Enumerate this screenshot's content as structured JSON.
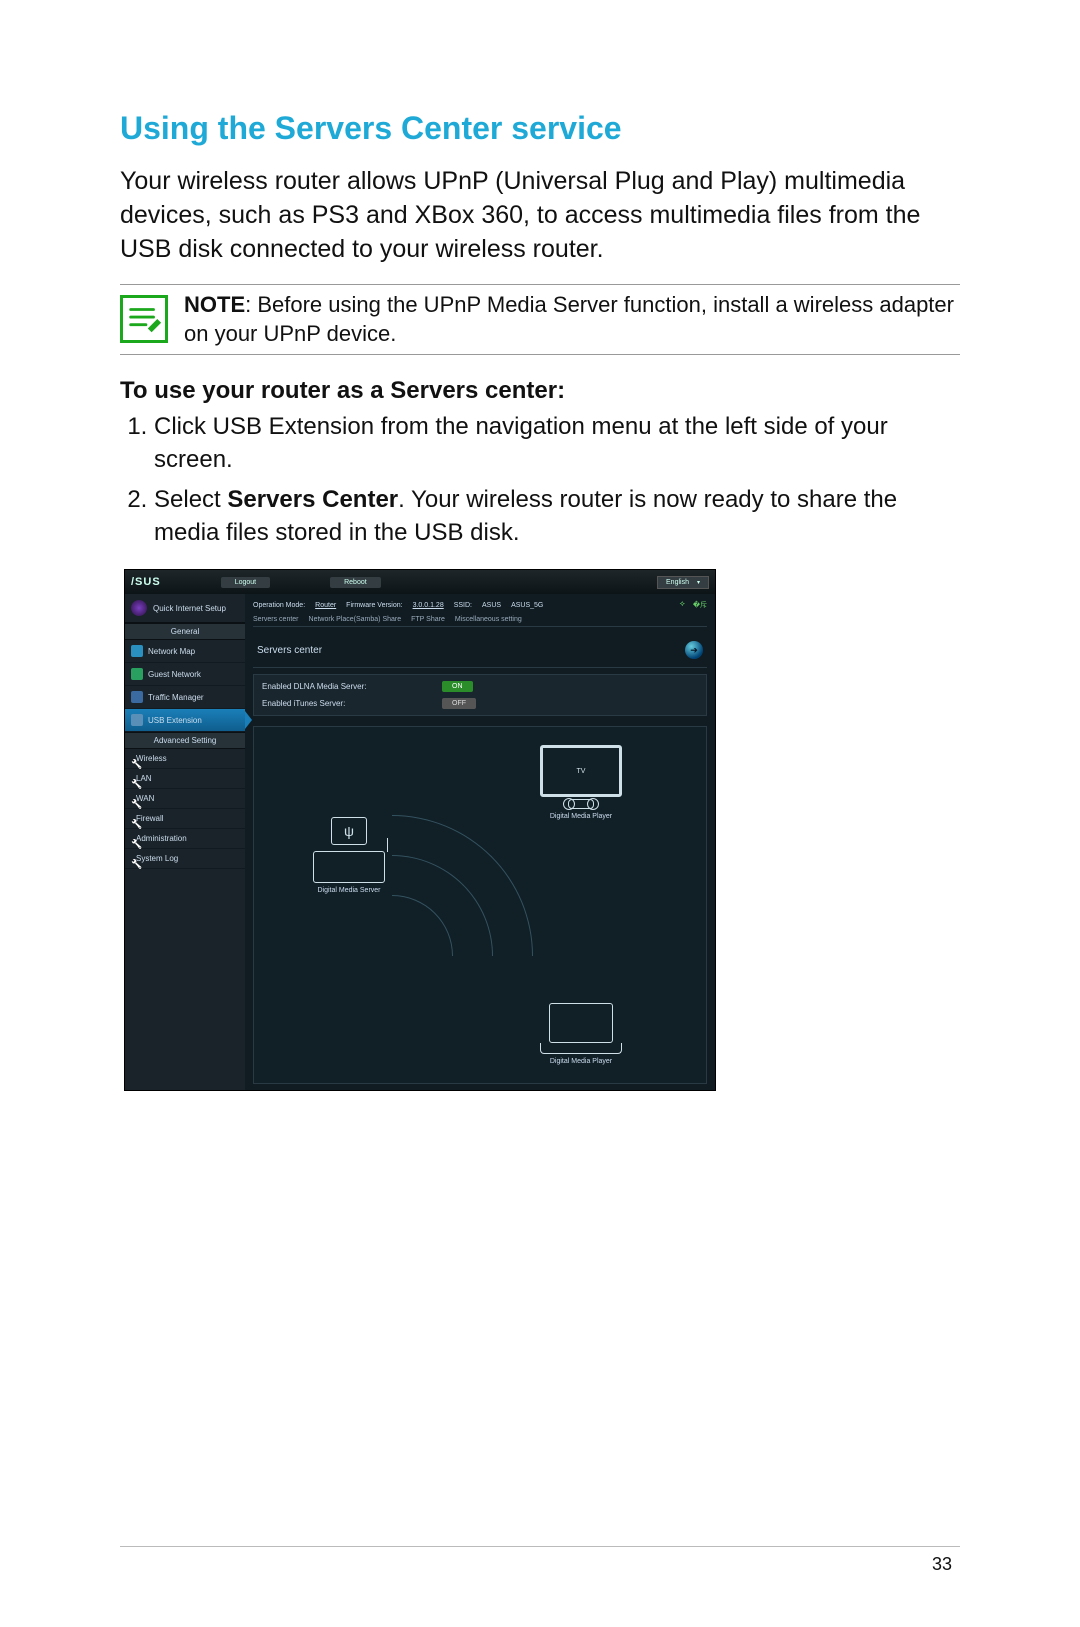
{
  "heading": "Using the Servers Center service",
  "intro": "Your wireless router allows UPnP (Universal Plug and Play) multimedia devices, such as PS3 and XBox 360, to access multimedia files from the USB disk connected to your wireless router.",
  "note": {
    "label": "NOTE",
    "text": ": Before using the UPnP Media Server function, install a wireless adapter on your UPnP device."
  },
  "subhead": "To use your router as a Servers center:",
  "steps": [
    "Click USB Extension from the navigation menu at the left side of your screen.",
    "Select <b>Servers Center</b>. Your wireless router is now ready to share the media files stored in the USB disk."
  ],
  "page_number": "33",
  "router": {
    "logo": "/SUS",
    "btn_logout": "Logout",
    "btn_reboot": "Reboot",
    "language": "English",
    "info": {
      "op_mode_lbl": "Operation Mode:",
      "op_mode_val": "Router",
      "fw_lbl": "Firmware Version:",
      "fw_val": "3.0.0.1.28",
      "ssid_lbl": "SSID:",
      "ssid1": "ASUS",
      "ssid2": "ASUS_5G"
    },
    "tabs": [
      "Servers center",
      "Network Place(Samba) Share",
      "FTP Share",
      "Miscellaneous setting"
    ],
    "panel_title": "Servers center",
    "settings": {
      "dlna_lbl": "Enabled DLNA Media Server:",
      "dlna_val": "ON",
      "itunes_lbl": "Enabled iTunes Server:",
      "itunes_val": "OFF"
    },
    "diagram": {
      "server_label": "Digital Media Server",
      "tv_label": "TV",
      "tv_caption": "Digital Media Player",
      "laptop_caption": "Digital Media Player"
    },
    "side": {
      "quick": "Quick Internet Setup",
      "cat_general": "General",
      "items_general": [
        "Network Map",
        "Guest Network",
        "Traffic Manager",
        "USB Extension"
      ],
      "cat_advanced": "Advanced Setting",
      "items_advanced": [
        "Wireless",
        "LAN",
        "WAN",
        "Firewall",
        "Administration",
        "System Log"
      ]
    }
  }
}
